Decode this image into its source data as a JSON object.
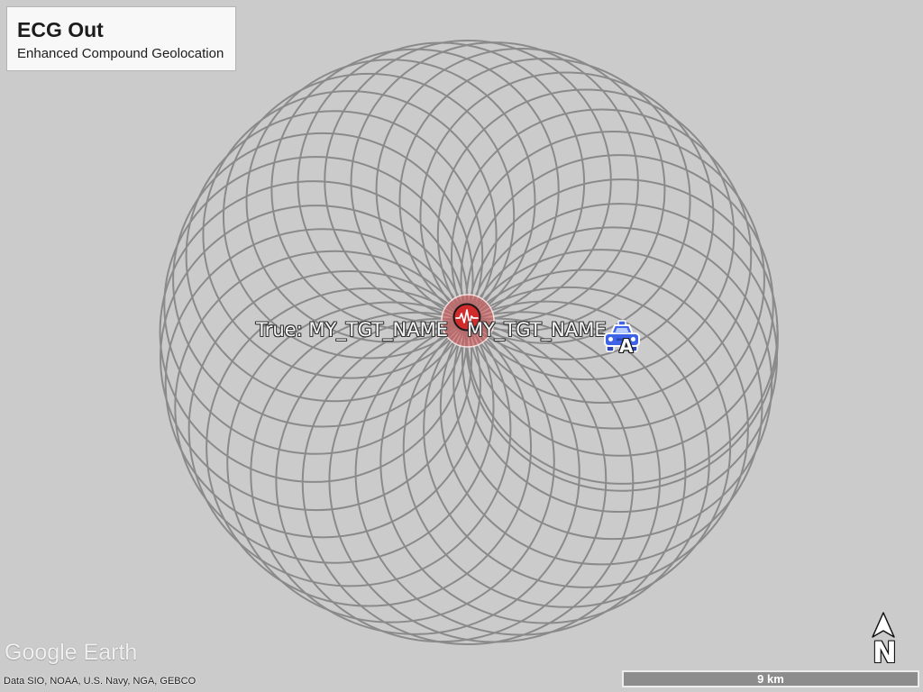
{
  "legend": {
    "title": "ECG Out",
    "subtitle": "Enhanced Compound Geolocation"
  },
  "placemarks": {
    "true_target": {
      "label": "True: MY_TGT_NAME",
      "icon": "ecg-icon"
    },
    "target": {
      "label": "MY_TGT_NAME"
    },
    "vehicle": {
      "label": "A",
      "icon": "car-icon"
    }
  },
  "compass": {
    "label": "N",
    "icon": "north-arrow-icon"
  },
  "scale_bar": {
    "label": "9 km"
  },
  "footer": {
    "logo": "Google Earth",
    "attribution": "Data SIO, NOAA, U.S. Navy, NGA, GEBCO"
  },
  "colors": {
    "background": "#cbcbcb",
    "rings": "#8a8a8a",
    "target_marker": "#d22b2b",
    "target_halo": "#d85656",
    "vehicle": "#3f63e6"
  }
}
